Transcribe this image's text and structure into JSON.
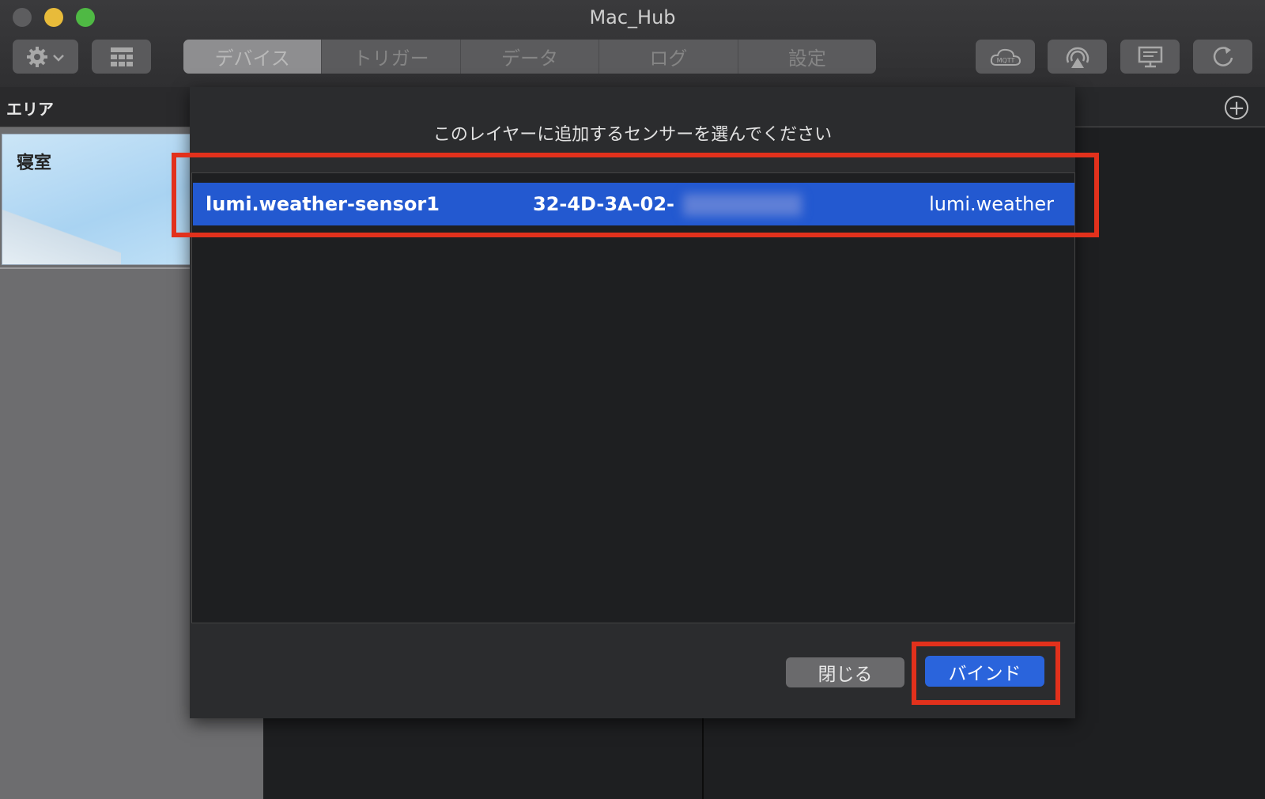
{
  "window": {
    "title": "Mac_Hub"
  },
  "toolbar": {
    "tabs": [
      {
        "label": "デバイス",
        "active": true
      },
      {
        "label": "トリガー",
        "active": false
      },
      {
        "label": "データ",
        "active": false
      },
      {
        "label": "ログ",
        "active": false
      },
      {
        "label": "設定",
        "active": false
      }
    ],
    "right_icons": [
      "mqtt-icon",
      "airplay-icon",
      "display-icon",
      "refresh-icon"
    ]
  },
  "sidebar": {
    "header": "エリア",
    "areas": [
      {
        "label": "寝室"
      }
    ]
  },
  "dialog": {
    "prompt": "このレイヤーに追加するセンサーを選んでください",
    "rows": [
      {
        "name": "lumi.weather-sensor1",
        "id_visible": "32-4D-3A-02-",
        "model": "lumi.weather",
        "selected": true
      }
    ],
    "close_label": "閉じる",
    "bind_label": "バインド"
  },
  "colors": {
    "selection": "#2359d0",
    "highlight": "#e2311c",
    "primary_button": "#2a64dc"
  }
}
